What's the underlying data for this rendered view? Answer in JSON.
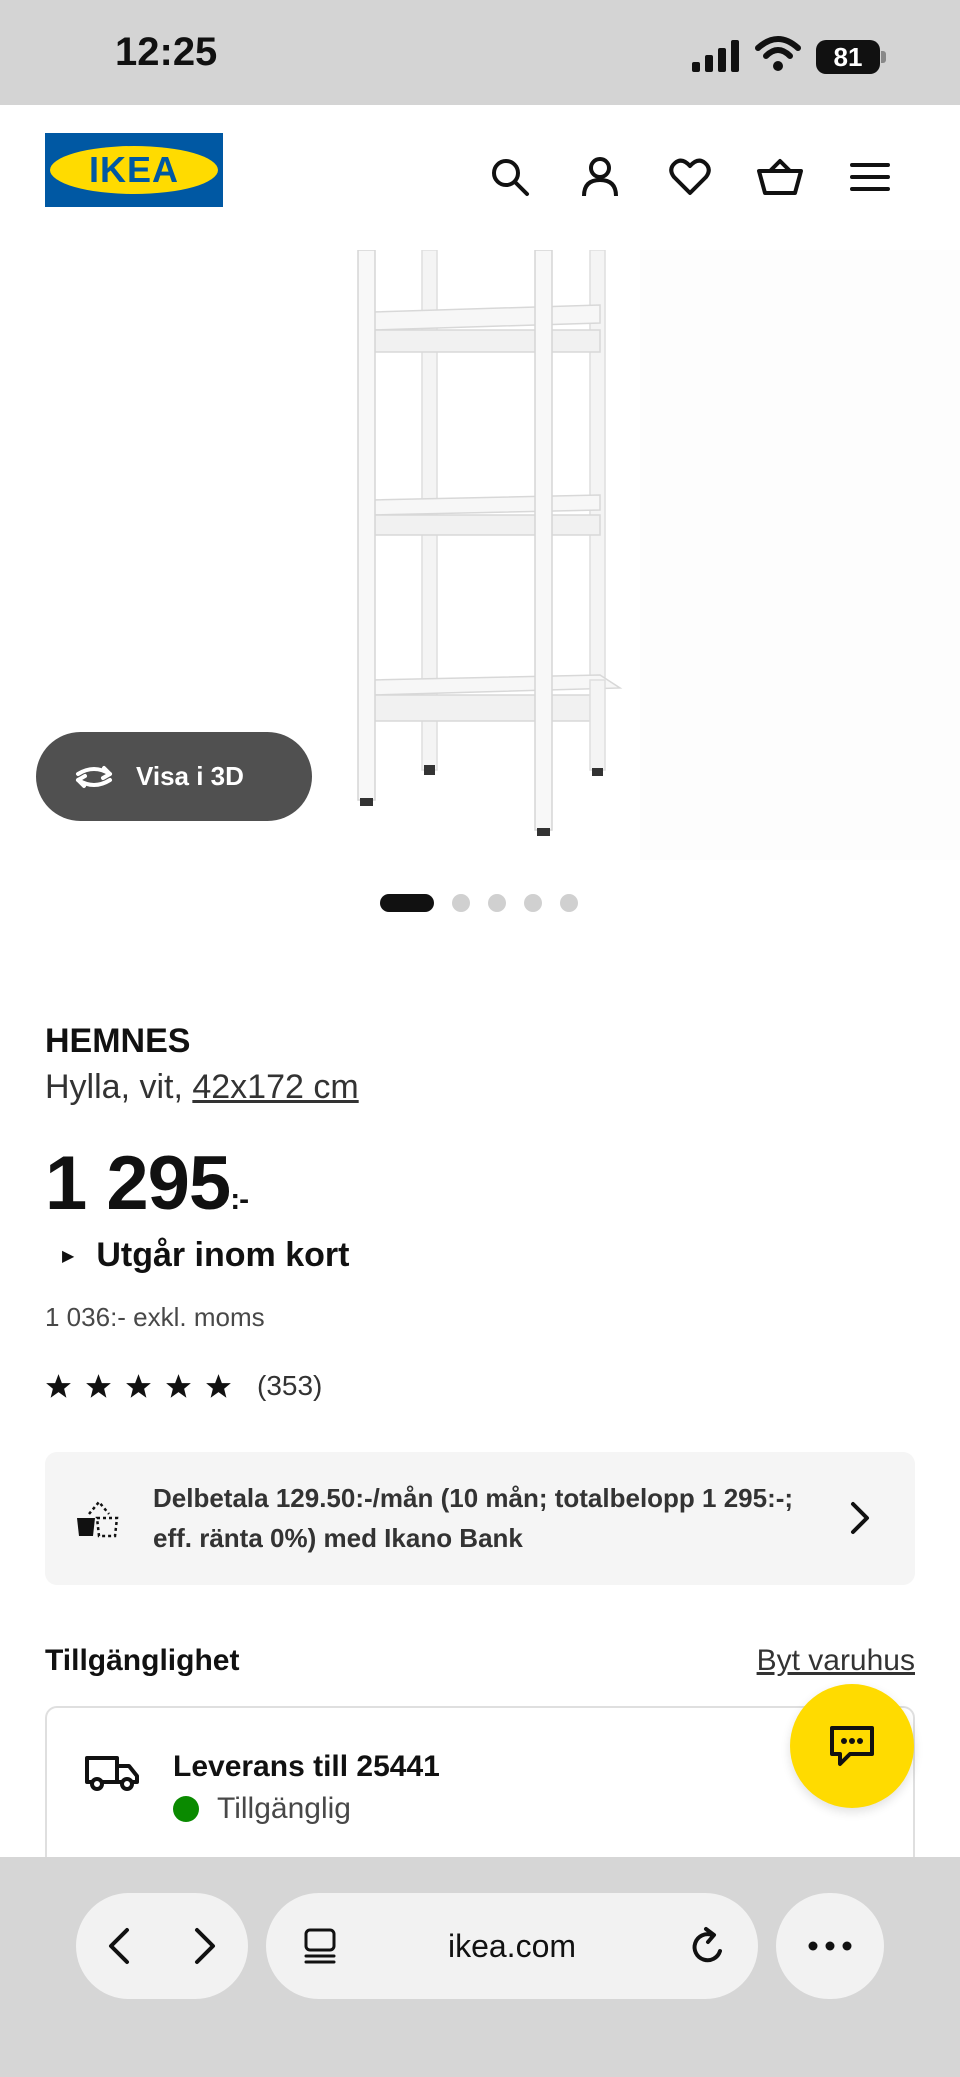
{
  "status_bar": {
    "time": "12:25",
    "battery": "81"
  },
  "header": {
    "logo_text": "IKEA",
    "icons": [
      "search-icon",
      "account-icon",
      "heart-icon",
      "basket-icon",
      "menu-icon"
    ]
  },
  "gallery": {
    "view_3d_label": "Visa i 3D",
    "slide_count": 5,
    "active_slide": 1
  },
  "product": {
    "name": "HEMNES",
    "description_prefix": "Hylla, vit, ",
    "size": "42x172 cm",
    "price_main": "1 295",
    "price_suffix": ":-",
    "availability_note": "Utgår inom kort",
    "excl_vat": "1 036:- exkl. moms",
    "rating_stars": 5,
    "rating_count": "(353)"
  },
  "financing": {
    "text": "Delbetala 129.50:-/mån (10 mån; totalbelopp 1 295:-; eff. ränta 0%) med Ikano Bank"
  },
  "availability": {
    "title": "Tillgänglighet",
    "change_store": "Byt varuhus",
    "delivery_title": "Leverans till 25441",
    "delivery_status": "Tillgänglig",
    "status_color": "#0a8a00"
  },
  "browser": {
    "url": "ikea.com"
  },
  "colors": {
    "brand_blue": "#0058a3",
    "brand_yellow": "#ffdb00"
  }
}
